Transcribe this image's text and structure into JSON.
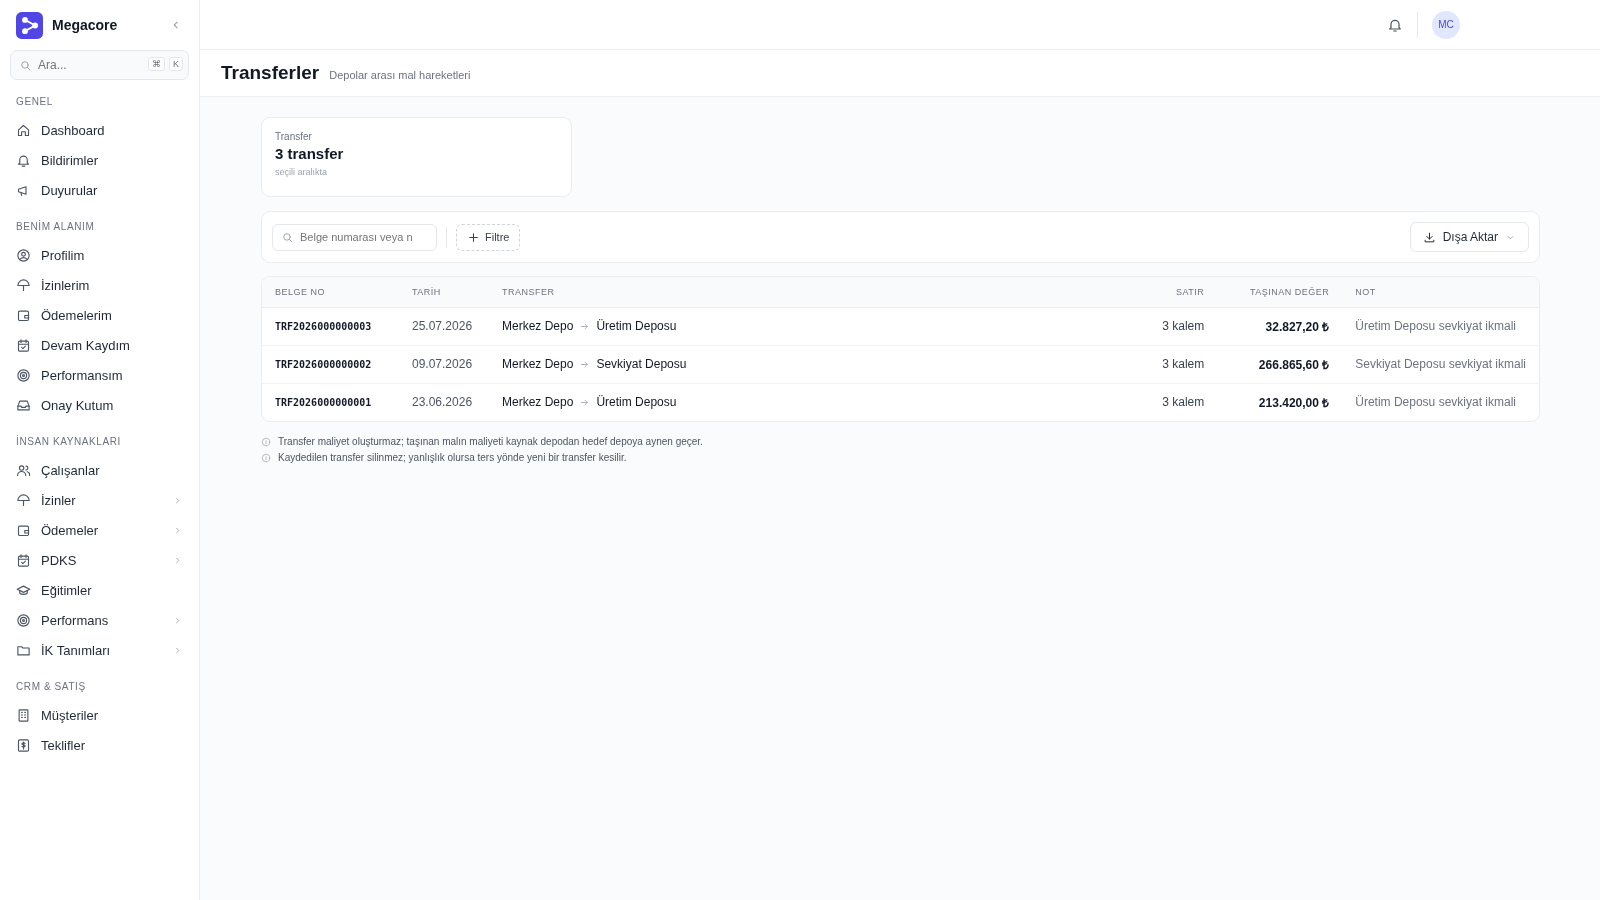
{
  "sidebar": {
    "brand": "Megacore",
    "search": {
      "placeholder": "Ara...",
      "keys": [
        "⌘",
        "K"
      ]
    },
    "sections": [
      {
        "title": "GENEL",
        "items": [
          {
            "label": "Dashboard",
            "has_children": false
          },
          {
            "label": "Bildirimler",
            "has_children": false
          },
          {
            "label": "Duyurular",
            "has_children": false
          }
        ]
      },
      {
        "title": "BENİM ALANIM",
        "items": [
          {
            "label": "Profilim",
            "has_children": false
          },
          {
            "label": "İzinlerim",
            "has_children": false
          },
          {
            "label": "Ödemelerim",
            "has_children": false
          },
          {
            "label": "Devam Kaydım",
            "has_children": false
          },
          {
            "label": "Performansım",
            "has_children": false
          },
          {
            "label": "Onay Kutum",
            "has_children": false
          }
        ]
      },
      {
        "title": "İNSAN KAYNAKLARI",
        "items": [
          {
            "label": "Çalışanlar",
            "has_children": false
          },
          {
            "label": "İzinler",
            "has_children": true
          },
          {
            "label": "Ödemeler",
            "has_children": true
          },
          {
            "label": "PDKS",
            "has_children": true
          },
          {
            "label": "Eğitimler",
            "has_children": false
          },
          {
            "label": "Performans",
            "has_children": true
          },
          {
            "label": "İK Tanımları",
            "has_children": true
          }
        ]
      },
      {
        "title": "CRM & SATIŞ",
        "items": [
          {
            "label": "Müşteriler",
            "has_children": false
          },
          {
            "label": "Teklifler",
            "has_children": false
          }
        ]
      }
    ]
  },
  "topbar": {
    "avatar": "MC"
  },
  "page": {
    "title": "Transferler",
    "subtitle": "Depolar arası mal hareketleri"
  },
  "stat_card": {
    "label": "Transfer",
    "value": "3 transfer",
    "caption": "seçili aralıkta"
  },
  "toolbar": {
    "search": {
      "placeholder": "Belge numarası veya n"
    },
    "filter": "Filtre",
    "export": "Dışa Aktar"
  },
  "table": {
    "columns": [
      "BELGE NO",
      "TARİH",
      "TRANSFER",
      "SATIR",
      "TAŞINAN DEĞER",
      "NOT"
    ],
    "rows": [
      {
        "doc": "TRF2026000000003",
        "date": "25.07.2026",
        "from": "Merkez Depo",
        "to": "Üretim Deposu",
        "lines": "3 kalem",
        "value": "32.827,20 ₺",
        "note": "Üretim Deposu sevkiyat ikmali"
      },
      {
        "doc": "TRF2026000000002",
        "date": "09.07.2026",
        "from": "Merkez Depo",
        "to": "Sevkiyat Deposu",
        "lines": "3 kalem",
        "value": "266.865,60 ₺",
        "note": "Sevkiyat Deposu sevkiyat ikmali"
      },
      {
        "doc": "TRF2026000000001",
        "date": "23.06.2026",
        "from": "Merkez Depo",
        "to": "Üretim Deposu",
        "lines": "3 kalem",
        "value": "213.420,00 ₺",
        "note": "Üretim Deposu sevkiyat ikmali"
      }
    ]
  },
  "notes": [
    "Transfer maliyet oluşturmaz; taşınan malın maliyeti kaynak depodan hedef depoya aynen geçer.",
    "Kaydedilen transfer silinmez; yanlışlık olursa ters yönde yeni bir transfer kesilir."
  ]
}
